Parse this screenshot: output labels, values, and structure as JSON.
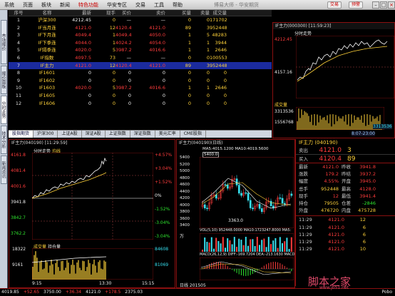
{
  "menu": [
    "系统",
    "页面",
    "板块",
    "新闻",
    "特色功能",
    "华安专区",
    "交易",
    "工具",
    "帮助"
  ],
  "window_title": "博易大师 - 华安期货",
  "top_buttons": {
    "trade": "交易",
    "alert": "预警"
  },
  "left_tabs": [
    "市场报价",
    "报价面板",
    "分时走势",
    "技术分析",
    "新闻资讯"
  ],
  "grid": {
    "headers": [
      "序号",
      "名称",
      "最新",
      "现手",
      "买价",
      "卖价",
      "买量",
      "卖量",
      "成交量"
    ],
    "rows": [
      [
        "1",
        "沪深300",
        "4212.45",
        "0",
        "—",
        "—",
        "0",
        "0",
        "171702914"
      ],
      [
        "2",
        "IF当月连",
        "4121.0",
        "12",
        "4120.4",
        "4121.0",
        "89",
        "3",
        "952448"
      ],
      [
        "3",
        "IF下月连",
        "4049.4",
        "1",
        "4049.4",
        "4050.0",
        "1",
        "5",
        "48283"
      ],
      [
        "4",
        "IF下季连",
        "4044.0",
        "1",
        "4024.2",
        "4054.0",
        "1",
        "1",
        "3944"
      ],
      [
        "5",
        "IF隔季连",
        "4020.0",
        "5",
        "3987.2",
        "4016.6",
        "1",
        "1",
        "2646"
      ],
      [
        "6",
        "IF指数",
        "4097.5",
        "73",
        "—",
        "—",
        "0",
        "0",
        "1005537"
      ],
      [
        "7",
        "IF主力",
        "4121.0",
        "12",
        "4120.4",
        "4121.0",
        "89",
        "3",
        "952448"
      ],
      [
        "8",
        "IF1601",
        "0",
        "0",
        "0",
        "0",
        "0",
        "0",
        "0"
      ],
      [
        "9",
        "IF1602",
        "0",
        "0",
        "0",
        "0",
        "0",
        "0",
        "0"
      ],
      [
        "10",
        "IF1603",
        "4020.0",
        "5",
        "3987.2",
        "4016.6",
        "1",
        "1",
        "2646"
      ],
      [
        "11",
        "IF1605",
        "0",
        "0",
        "0",
        "0",
        "0",
        "0",
        "0"
      ],
      [
        "12",
        "IF1606",
        "0",
        "0",
        "0",
        "0",
        "0",
        "0",
        "0"
      ]
    ],
    "selected_row": 6
  },
  "bottom_tabs": [
    "股指期货",
    "沪深300",
    "上证A股",
    "深证A股",
    "上证指数",
    "深证指数",
    "美元汇率",
    "CME股指"
  ],
  "mini_chart": {
    "title": "IF主力(000300)",
    "time": "11:59:23",
    "label": "分时走势",
    "price_hi": "4212.45",
    "price_lo": "4157.16",
    "vol_label": "成交量",
    "vol_hi": "3313536",
    "vol_lo": "1556768",
    "vol_right": "3313536",
    "footer": "8:07-23:00"
  },
  "left_chart": {
    "title": "IF主力(040190)",
    "time": "11:29:59",
    "label": "分时走势",
    "sub": "均线",
    "prices": [
      "4161.8",
      "4081.4",
      "4001.6",
      "3941.8",
      "3842.7",
      "3762.2"
    ],
    "pcts": [
      "+4.57%",
      "+3.04%",
      "+1.52%",
      "0%",
      "-1.52%",
      "-3.04%",
      "-3.04%"
    ],
    "vol_label": "成交量",
    "oi_label": "持仓量",
    "vol_lvls": [
      "18322",
      "9161"
    ],
    "oi_lvls": [
      "84608",
      "81069"
    ],
    "times": [
      "9:15",
      "13:30",
      "15:15"
    ]
  },
  "kline": {
    "title": "IF主力(040190)(日线)",
    "ma": "MA5:4015.1200 MA10:4019.5600",
    "price_box": "5400.0",
    "high": "5400.0",
    "levels": [
      "5400",
      "5200",
      "5000",
      "4800",
      "4600",
      "4400",
      "4200",
      "4000",
      "3800",
      "3600",
      "3400"
    ],
    "low": "3363.0",
    "vol": "VOL(5,10) 952448.0000 MA10:1723247.8000 MA5:",
    "vol_unit": "万",
    "macd": "MACD(26,12,9) DIFF:-169.7204 DEA:-213.1630 MACD:",
    "date_label": "日线 201505"
  },
  "quote": {
    "title": "IF主力 (040190)",
    "sell": {
      "label": "卖出",
      "price": "4121.0",
      "vol": "3"
    },
    "buy": {
      "label": "买入",
      "price": "4120.4",
      "vol": "89"
    },
    "rows": [
      [
        "最新",
        "4121.0",
        "昨收",
        "3941.8"
      ],
      [
        "涨跌",
        "179.2",
        "昨结",
        "3937.2"
      ],
      [
        "幅度",
        "4.55%",
        "开盘",
        "3945.0"
      ],
      [
        "总手",
        "952448",
        "最高",
        "4128.0"
      ],
      [
        "现手",
        "12",
        "最低",
        "3941.4"
      ],
      [
        "持仓",
        "79505",
        "仓差",
        "-2846"
      ],
      [
        "外盘",
        "476720",
        "内盘",
        "475728"
      ]
    ],
    "ticks": [
      [
        "11:29",
        "4121.0",
        "12"
      ],
      [
        "11:29",
        "4121.0",
        "6"
      ],
      [
        "11:29",
        "4121.0",
        "6"
      ],
      [
        "11:29",
        "4121.0",
        "6"
      ],
      [
        "11:29",
        "4121.0",
        "10"
      ]
    ]
  },
  "status": {
    "items": [
      "4019.85",
      "+52.65",
      "3750.00",
      "+36.34",
      "4121.0",
      "+178.5",
      "2375.03"
    ],
    "right": "Pobo"
  },
  "watermark": {
    "main": "脚本之家",
    "url": "www.jb51.net"
  }
}
